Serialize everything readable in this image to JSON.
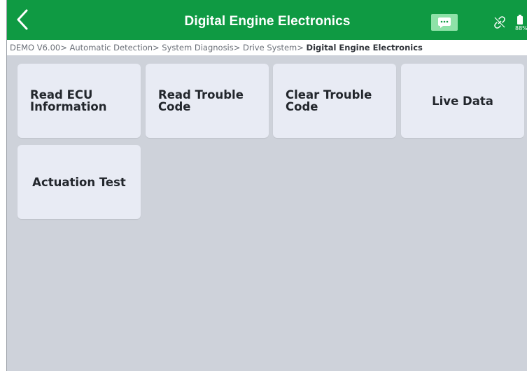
{
  "header": {
    "title": "Digital Engine Electronics",
    "battery_percent": "88%",
    "accent_color": "#0f9a43"
  },
  "breadcrumb": {
    "path": "DEMO V6.00> Automatic Detection> System Diagnosis> Drive System> ",
    "current": "Digital Engine Electronics"
  },
  "functions": [
    {
      "label": "Read ECU Information"
    },
    {
      "label": "Read Trouble Code"
    },
    {
      "label": "Clear Trouble Code"
    },
    {
      "label": "Live Data"
    },
    {
      "label": "Actuation Test"
    }
  ],
  "icons": [
    "back-icon",
    "message-icon",
    "link-icon",
    "battery-icon"
  ]
}
